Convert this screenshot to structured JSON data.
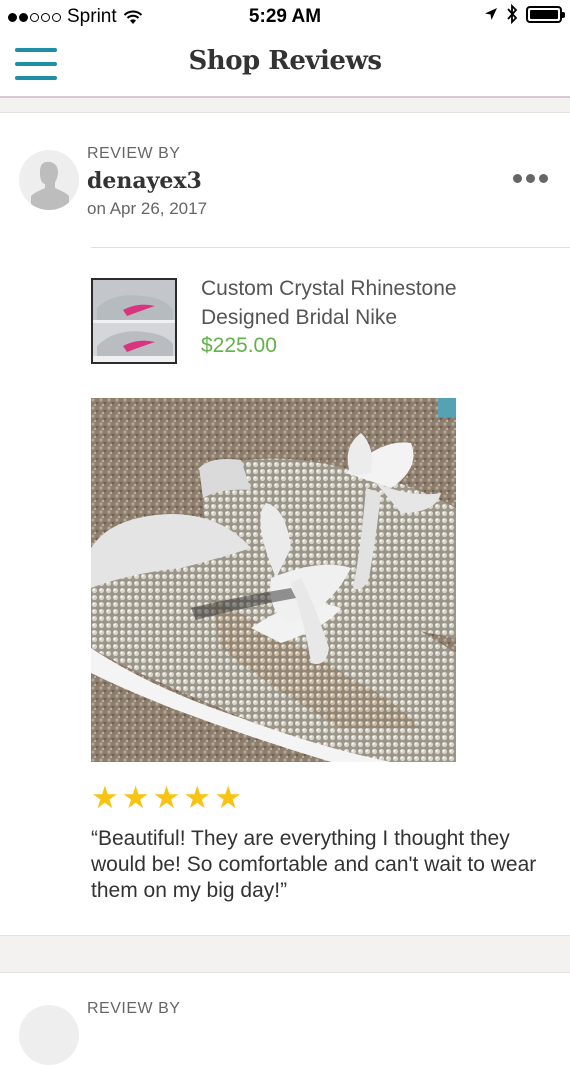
{
  "status_bar": {
    "carrier": "Sprint",
    "time": "5:29 AM",
    "signal_dots": [
      true,
      true,
      false,
      false,
      false
    ]
  },
  "nav": {
    "title": "Shop Reviews",
    "menu_icon": "hamburger-menu-icon"
  },
  "review": {
    "label": "REVIEW BY",
    "username": "denayex3",
    "date": "on Apr 26, 2017",
    "more_icon": "more-options-icon",
    "product": {
      "name": "Custom Crystal Rhinestone Designed Bridal Nike",
      "price": "$225.00"
    },
    "rating": 5,
    "text": "“Beautiful! They are everything I thought they would be! So comfortable and can't wait to wear them on my big day!”"
  },
  "next_review": {
    "label": "REVIEW BY"
  },
  "colors": {
    "accent": "#1f8fa6",
    "price": "#62b249",
    "star": "#f7c414"
  }
}
